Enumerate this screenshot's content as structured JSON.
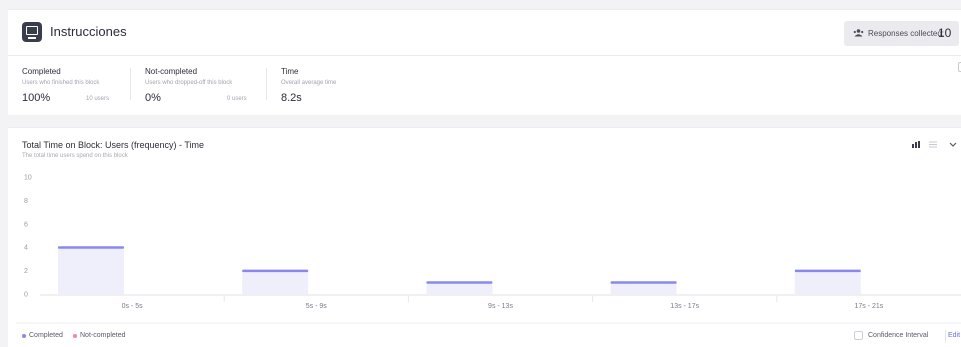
{
  "header": {
    "title": "Instrucciones",
    "responses_label": "Responses collected:",
    "responses_value": "10"
  },
  "stats": [
    {
      "label": "Completed",
      "sub": "Users who finished this block",
      "value": "100%",
      "users": "10 users"
    },
    {
      "label": "Not-completed",
      "sub": "Users who dropped-off this block",
      "value": "0%",
      "users": "0 users"
    },
    {
      "label": "Time",
      "sub": "Overall average time",
      "value": "8.2s"
    }
  ],
  "chart_section": {
    "title": "Total Time on Block: Users (frequency) - Time",
    "subtitle": "The total time users spend on this block",
    "icons": [
      "bar-chart-icon",
      "list-icon",
      "chevron-down-icon"
    ]
  },
  "chart_data": {
    "type": "bar",
    "categories": [
      "0s - 5s",
      "5s - 9s",
      "9s - 13s",
      "13s - 17s",
      "17s - 21s"
    ],
    "series": [
      {
        "name": "Completed",
        "values": [
          4,
          2,
          1,
          1,
          2
        ],
        "color": "#8a87f0"
      },
      {
        "name": "Not-completed",
        "values": [
          0,
          0,
          0,
          0,
          0
        ],
        "color": "#f08a9a"
      }
    ],
    "yticks": [
      "0",
      "2",
      "4",
      "6",
      "8",
      "10"
    ],
    "ylim": [
      0,
      10
    ],
    "grid": false,
    "legend_position": "bottom-left",
    "bar_fill": "#efeffb"
  },
  "legend": [
    {
      "label": "Completed",
      "color": "#8a87f0"
    },
    {
      "label": "Not-completed",
      "color": "#f08a9a"
    }
  ],
  "footer": {
    "confidence_label": "Confidence Interval",
    "edit_label": "Edit"
  },
  "colors": {
    "accent": "#6b6fd8",
    "bar_top": "#8a87f0"
  }
}
